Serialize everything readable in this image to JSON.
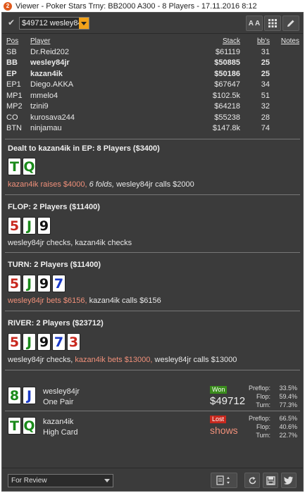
{
  "window": {
    "title": "Viewer - Poker Stars Trny: BB2000 A300 - 8 Players - 17.11.2016 8:12",
    "icon": "2"
  },
  "toolbar": {
    "player_select": "$49712 wesley84jr",
    "font_button": "A A",
    "grid_icon": "grid-icon",
    "edit_icon": "pencil-icon"
  },
  "table": {
    "headers": {
      "pos": "Pos",
      "player": "Player",
      "stack": "Stack",
      "bbs": "bb's",
      "notes": "Notes"
    },
    "rows": [
      {
        "pos": "SB",
        "player": "Dr.Reid202",
        "stack": "$61119",
        "bbs": "31"
      },
      {
        "pos": "BB",
        "player": "wesley84jr",
        "stack": "$50885",
        "bbs": "25"
      },
      {
        "pos": "EP",
        "player": "kazan4ik",
        "stack": "$50186",
        "bbs": "25"
      },
      {
        "pos": "EP1",
        "player": "Diego.AKKA",
        "stack": "$67647",
        "bbs": "34"
      },
      {
        "pos": "MP1",
        "player": "mmelo4",
        "stack": "$102.5k",
        "bbs": "51"
      },
      {
        "pos": "MP2",
        "player": "tzini9",
        "stack": "$64218",
        "bbs": "32"
      },
      {
        "pos": "CO",
        "player": "kurosava244",
        "stack": "$55238",
        "bbs": "28"
      },
      {
        "pos": "BTN",
        "player": "ninjamau",
        "stack": "$147.8k",
        "bbs": "74"
      }
    ]
  },
  "preflop": {
    "title": "Dealt to kazan4ik in EP: 8 Players ($3400)",
    "cards": [
      {
        "rank": "T",
        "color": "#1a8a1a"
      },
      {
        "rank": "Q",
        "color": "#1a8a1a"
      }
    ],
    "action_hl": "kazan4ik raises $4000,",
    "action_it": " 6 folds,",
    "action_rest": " wesley84jr calls $2000"
  },
  "flop": {
    "title": "FLOP: 2 Players ($11400)",
    "cards": [
      {
        "rank": "5",
        "color": "#c8281e"
      },
      {
        "rank": "J",
        "color": "#1a8a1a"
      },
      {
        "rank": "9",
        "color": "#111111"
      }
    ],
    "action": "wesley84jr checks, kazan4ik checks"
  },
  "turn": {
    "title": "TURN: 2 Players ($11400)",
    "cards": [
      {
        "rank": "5",
        "color": "#c8281e"
      },
      {
        "rank": "J",
        "color": "#1a8a1a"
      },
      {
        "rank": "9",
        "color": "#111111"
      },
      {
        "rank": "7",
        "color": "#1a3ac8"
      }
    ],
    "action_hl": "wesley84jr bets $6156,",
    "action_rest": " kazan4ik calls $6156"
  },
  "river": {
    "title": "RIVER: 2 Players ($23712)",
    "cards": [
      {
        "rank": "5",
        "color": "#c8281e"
      },
      {
        "rank": "J",
        "color": "#1a8a1a"
      },
      {
        "rank": "9",
        "color": "#111111"
      },
      {
        "rank": "7",
        "color": "#1a3ac8"
      },
      {
        "rank": "3",
        "color": "#c8281e"
      }
    ],
    "action_a": "wesley84jr checks, ",
    "action_hl": "kazan4ik bets $13000,",
    "action_rest": " wesley84jr calls $13000"
  },
  "results": [
    {
      "name": "wesley84jr",
      "hand": "One Pair",
      "cards": [
        {
          "rank": "8",
          "color": "#1a8a1a"
        },
        {
          "rank": "J",
          "color": "#1a3ac8"
        }
      ],
      "badge": "Won",
      "amount": "$49712",
      "equity": [
        {
          "label": "Preflop:",
          "value": "33.5%"
        },
        {
          "label": "Flop:",
          "value": "59.4%"
        },
        {
          "label": "Turn:",
          "value": "77.3%"
        }
      ]
    },
    {
      "name": "kazan4ik",
      "hand": "High Card",
      "cards": [
        {
          "rank": "T",
          "color": "#1a8a1a"
        },
        {
          "rank": "Q",
          "color": "#1a8a1a"
        }
      ],
      "badge": "Lost",
      "amount": "shows",
      "equity": [
        {
          "label": "Preflop:",
          "value": "66.5%"
        },
        {
          "label": "Flop:",
          "value": "40.6%"
        },
        {
          "label": "Turn:",
          "value": "22.7%"
        }
      ]
    }
  ],
  "bottombar": {
    "review_select": "For Review"
  },
  "colors": {
    "accent": "#f2a21a",
    "highlight": "#f0907a",
    "won": "#3a8c1c",
    "lost": "#c8281e",
    "panel": "#3b3b3b"
  }
}
